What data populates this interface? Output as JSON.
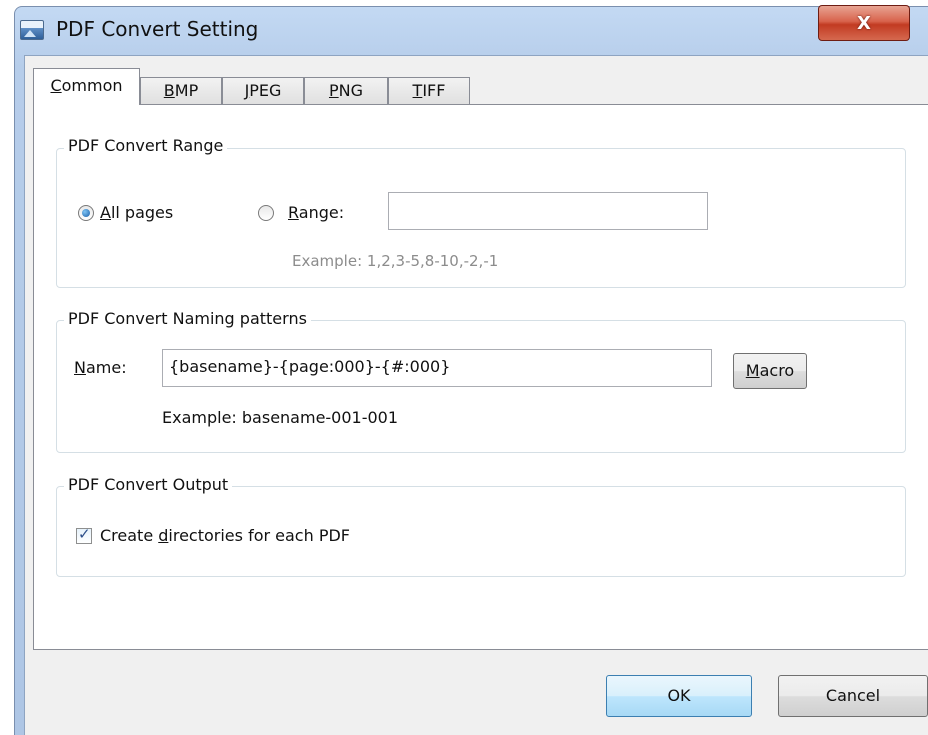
{
  "window": {
    "title": "PDF Convert Setting",
    "close_label": "X"
  },
  "tabs": [
    {
      "label": "Common",
      "mnemonic": "C",
      "rest": "ommon"
    },
    {
      "label": "BMP",
      "mnemonic": "B",
      "rest": "MP"
    },
    {
      "label": "JPEG",
      "mnemonic": "J",
      "rest": "PEG"
    },
    {
      "label": "PNG",
      "mnemonic": "P",
      "rest": "NG"
    },
    {
      "label": "TIFF",
      "mnemonic": "T",
      "rest": "IFF"
    }
  ],
  "range_group": {
    "title": "PDF Convert Range",
    "all_pages": {
      "mnemonic": "A",
      "rest": "ll pages",
      "checked": true
    },
    "range": {
      "mnemonic": "R",
      "rest": "ange:",
      "checked": false,
      "value": ""
    },
    "example": "Example: 1,2,3-5,8-10,-2,-1"
  },
  "naming_group": {
    "title": "PDF Convert Naming patterns",
    "name_label": {
      "mnemonic": "N",
      "rest": "ame:"
    },
    "name_value": "{basename}-{page:000}-{#:000}",
    "macro_button": {
      "mnemonic": "M",
      "rest": "acro"
    },
    "example": "Example:  basename-001-001"
  },
  "output_group": {
    "title": "PDF Convert Output",
    "create_dirs": {
      "before": "Create ",
      "mnemonic": "d",
      "after": "irectories for each PDF",
      "checked": true
    }
  },
  "buttons": {
    "ok": "OK",
    "cancel": "Cancel"
  }
}
